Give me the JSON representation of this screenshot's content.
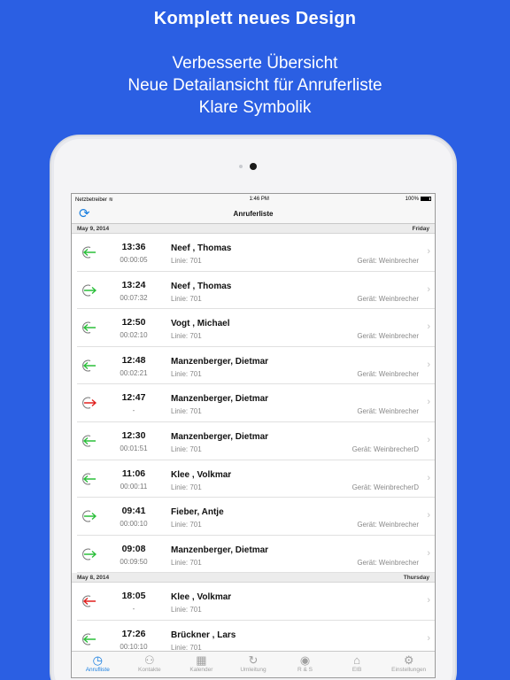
{
  "promo": {
    "headline": "Komplett neues Design",
    "line1": "Verbesserte Übersicht",
    "line2": "Neue Detailansicht für Anruferliste",
    "line3": "Klare Symbolik"
  },
  "statusbar": {
    "carrier": "Netzbetreiber",
    "time": "1:46 PM",
    "battery": "100%"
  },
  "navbar": {
    "title": "Anruferliste",
    "refresh_icon": "refresh-icon"
  },
  "colors": {
    "incoming": "#2bbf3a",
    "outgoing": "#2bbf3a",
    "missed": "#e0201e",
    "accent": "#1a7fe0",
    "background": "#2b5fe3"
  },
  "sections": [
    {
      "date": "May 9, 2014",
      "day": "Friday",
      "calls": [
        {
          "time": "13:36",
          "duration": "00:00:05",
          "name": "Neef , Thomas",
          "line": "Linie: 701",
          "device": "Gerät: Weinbrecher",
          "direction": "incoming"
        },
        {
          "time": "13:24",
          "duration": "00:07:32",
          "name": "Neef , Thomas",
          "line": "Linie: 701",
          "device": "Gerät: Weinbrecher",
          "direction": "outgoing"
        },
        {
          "time": "12:50",
          "duration": "00:02:10",
          "name": "Vogt , Michael",
          "line": "Linie: 701",
          "device": "Gerät: Weinbrecher",
          "direction": "incoming"
        },
        {
          "time": "12:48",
          "duration": "00:02:21",
          "name": "Manzenberger, Dietmar",
          "line": "Linie: 701",
          "device": "Gerät: Weinbrecher",
          "direction": "incoming"
        },
        {
          "time": "12:47",
          "duration": "-",
          "name": "Manzenberger, Dietmar",
          "line": "Linie: 701",
          "device": "Gerät: Weinbrecher",
          "direction": "missed"
        },
        {
          "time": "12:30",
          "duration": "00:01:51",
          "name": "Manzenberger, Dietmar",
          "line": "Linie: 701",
          "device": "Gerät: WeinbrecherD",
          "direction": "incoming"
        },
        {
          "time": "11:06",
          "duration": "00:00:11",
          "name": "Klee , Volkmar",
          "line": "Linie: 701",
          "device": "Gerät: WeinbrecherD",
          "direction": "incoming"
        },
        {
          "time": "09:41",
          "duration": "00:00:10",
          "name": "Fieber, Antje",
          "line": "Linie: 701",
          "device": "Gerät: Weinbrecher",
          "direction": "outgoing"
        },
        {
          "time": "09:08",
          "duration": "00:09:50",
          "name": "Manzenberger, Dietmar",
          "line": "Linie: 701",
          "device": "Gerät: Weinbrecher",
          "direction": "outgoing"
        }
      ]
    },
    {
      "date": "May 8, 2014",
      "day": "Thursday",
      "calls": [
        {
          "time": "18:05",
          "duration": "-",
          "name": "Klee , Volkmar",
          "line": "Linie: 701",
          "device": "",
          "direction": "missed-in"
        },
        {
          "time": "17:26",
          "duration": "00:10:10",
          "name": "Brückner , Lars",
          "line": "Linie: 701",
          "device": "",
          "direction": "incoming"
        }
      ]
    }
  ],
  "tabs": [
    {
      "label": "Anrufliste",
      "icon": "clock-icon",
      "glyph": "◷",
      "active": true
    },
    {
      "label": "Kontakte",
      "icon": "contacts-icon",
      "glyph": "⚇",
      "active": false
    },
    {
      "label": "Kalender",
      "icon": "calendar-icon",
      "glyph": "▦",
      "active": false
    },
    {
      "label": "Umleitung",
      "icon": "redirect-icon",
      "glyph": "↻",
      "active": false
    },
    {
      "label": "R & S",
      "icon": "eye-icon",
      "glyph": "◉",
      "active": false
    },
    {
      "label": "EIB",
      "icon": "home-icon",
      "glyph": "⌂",
      "active": false
    },
    {
      "label": "Einstellungen",
      "icon": "gear-icon",
      "glyph": "⚙",
      "active": false
    }
  ]
}
